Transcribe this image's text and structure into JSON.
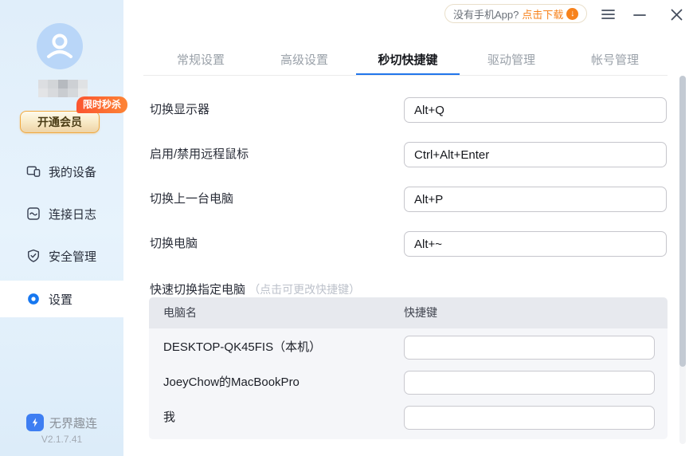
{
  "titlebar": {
    "app_download": {
      "prompt": "没有手机App?",
      "action": "点击下载"
    }
  },
  "sidebar": {
    "flash_badge": "限时秒杀",
    "vip_button": "开通会员",
    "menu": [
      {
        "label": "我的设备",
        "icon": "devices-icon",
        "active": false
      },
      {
        "label": "连接日志",
        "icon": "log-icon",
        "active": false
      },
      {
        "label": "安全管理",
        "icon": "shield-icon",
        "active": false
      },
      {
        "label": "设置",
        "icon": "settings-icon",
        "active": true
      }
    ],
    "brand": {
      "name": "无界趣连",
      "version": "V2.1.7.41"
    }
  },
  "tabs": {
    "items": [
      {
        "label": "常规设置",
        "active": false
      },
      {
        "label": "高级设置",
        "active": false
      },
      {
        "label": "秒切快捷键",
        "active": true
      },
      {
        "label": "驱动管理",
        "active": false
      },
      {
        "label": "帐号管理",
        "active": false
      }
    ]
  },
  "hotkeys": {
    "rows": [
      {
        "label": "切换显示器",
        "value": "Alt+Q"
      },
      {
        "label": "启用/禁用远程鼠标",
        "value": "Ctrl+Alt+Enter"
      },
      {
        "label": "切换上一台电脑",
        "value": "Alt+P"
      },
      {
        "label": "切换电脑",
        "value": "Alt+~"
      }
    ],
    "quick_switch": {
      "title": "快速切换指定电脑",
      "hint": "（点击可更改快捷键）",
      "columns": {
        "name": "电脑名",
        "hotkey": "快捷键"
      },
      "computers": [
        {
          "name": "DESKTOP-QK45FIS（本机）",
          "hotkey": ""
        },
        {
          "name": "JoeyChow的MacBookPro",
          "hotkey": ""
        },
        {
          "name": "我",
          "hotkey": ""
        }
      ]
    }
  },
  "colors": {
    "accent_blue": "#2176ec",
    "accent_orange": "#f7821c",
    "badge_orange": "#fb5d2d",
    "sidebar_bg": "#e3f0fb"
  }
}
